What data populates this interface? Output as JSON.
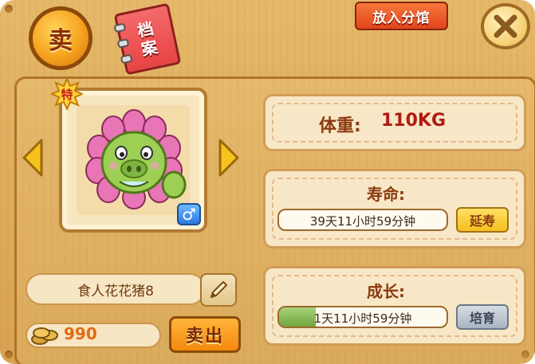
{
  "tabs": {
    "sell": "卖",
    "archive_line1": "档",
    "archive_line2": "案"
  },
  "header": {
    "place_button": "放入分馆"
  },
  "pet": {
    "badge": "特",
    "gender_symbol": "♂",
    "name": "食人花花猪8"
  },
  "coins": {
    "value": "990"
  },
  "actions": {
    "sell_button": "卖出"
  },
  "weight": {
    "label": "体重:",
    "value": "110KG"
  },
  "lifespan": {
    "title": "寿命:",
    "remaining": "39天11小时59分钟",
    "extend_button": "延寿"
  },
  "growth": {
    "title": "成长:",
    "remaining": "1天11小时59分钟",
    "progress": 0.22,
    "breed_button": "培育"
  },
  "icons": {
    "close": "close-icon",
    "prev": "arrow-left-icon",
    "next": "arrow-right-icon",
    "edit": "pencil-icon",
    "coin": "coin-stack-icon"
  },
  "colors": {
    "accent_orange": "#f5880e",
    "value_red": "#b21a12",
    "coin_orange": "#e36a12"
  }
}
